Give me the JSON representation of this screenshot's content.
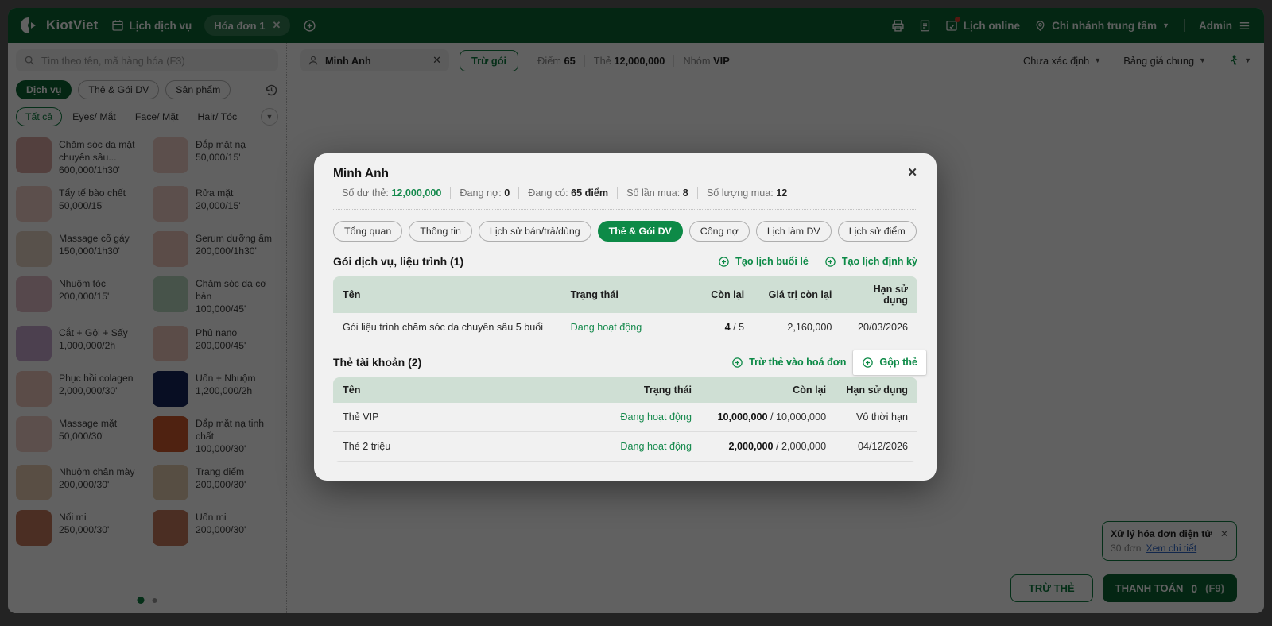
{
  "topbar": {
    "brand": "KiotViet",
    "schedule": "Lịch dịch vụ",
    "invoice_tab": "Hóa đơn 1",
    "lich_online": "Lịch online",
    "branch": "Chi nhánh trung tâm",
    "admin": "Admin"
  },
  "sidebar": {
    "search_placeholder": "Tìm theo tên, mã hàng hóa (F3)",
    "type_chips": [
      {
        "label": "Dịch vụ",
        "active": true
      },
      {
        "label": "Thẻ & Gói DV"
      },
      {
        "label": "Sản phẩm"
      }
    ],
    "categories": [
      {
        "label": "Tất cả",
        "active": true
      },
      {
        "label": "Eyes/ Mắt"
      },
      {
        "label": "Face/ Mặt"
      },
      {
        "label": "Hair/ Tóc"
      }
    ],
    "services": [
      {
        "name": "Chăm sóc da mặt chuyên sâu...",
        "price": "600,000/1h30'",
        "thumb": "#dba9a4"
      },
      {
        "name": "Đắp mặt nạ",
        "price": "50,000/15'",
        "thumb": "#f2cfc8"
      },
      {
        "name": "Tẩy tế bào chết",
        "price": "50,000/15'",
        "thumb": "#f2cfc8"
      },
      {
        "name": "Rửa mặt",
        "price": "20,000/15'",
        "thumb": "#f2cfc8"
      },
      {
        "name": "Massage cổ gáy",
        "price": "150,000/1h30'",
        "thumb": "#e8d6c6"
      },
      {
        "name": "Serum dưỡng ẩm",
        "price": "200,000/1h30'",
        "thumb": "#eec7bd"
      },
      {
        "name": "Nhuộm tóc",
        "price": "200,000/15'",
        "thumb": "#e3bdc8"
      },
      {
        "name": "Chăm sóc da cơ bản",
        "price": "100,000/45'",
        "thumb": "#bcd9c3"
      },
      {
        "name": "Cắt + Gội + Sấy",
        "price": "1,000,000/2h",
        "thumb": "#c9a9cf"
      },
      {
        "name": "Phủ nano",
        "price": "200,000/45'",
        "thumb": "#eec7bd"
      },
      {
        "name": "Phục hồi colagen",
        "price": "2,000,000/30'",
        "thumb": "#eec7bd"
      },
      {
        "name": "Uốn + Nhuộm",
        "price": "1,200,000/2h",
        "thumb": "#16255c"
      },
      {
        "name": "Massage mặt",
        "price": "50,000/30'",
        "thumb": "#f2cfc8"
      },
      {
        "name": "Đắp mặt nạ tinh chất",
        "price": "100,000/30'",
        "thumb": "#cf5b2e"
      },
      {
        "name": "Nhuộm chân mày",
        "price": "200,000/30'",
        "thumb": "#e9cdb4"
      },
      {
        "name": "Trang điểm",
        "price": "200,000/30'",
        "thumb": "#e5cdb0"
      },
      {
        "name": "Nối mi",
        "price": "250,000/30'",
        "thumb": "#c6795c"
      },
      {
        "name": "Uốn mi",
        "price": "200,000/30'",
        "thumb": "#c6795c"
      }
    ]
  },
  "main": {
    "customer_name": "Minh Anh",
    "tru_goi": "Trừ gói",
    "customer_stats": [
      {
        "label": "Điểm ",
        "value": "65"
      },
      {
        "label": "Thẻ ",
        "value": "12,000,000"
      },
      {
        "label": "Nhóm ",
        "value": "VIP"
      }
    ],
    "price_channel": "Chưa xác định",
    "price_list": "Bảng giá chung"
  },
  "modal": {
    "title": "Minh Anh",
    "stats": [
      {
        "label": "Số dư thẻ: ",
        "value": "12,000,000",
        "green": true
      },
      {
        "label": "Đang nợ: ",
        "value": "0"
      },
      {
        "label": "Đang có: ",
        "value": "65 điểm"
      },
      {
        "label": "Số lần mua: ",
        "value": "8"
      },
      {
        "label": "Số lượng mua: ",
        "value": "12"
      }
    ],
    "tabs": [
      {
        "label": "Tổng quan"
      },
      {
        "label": "Thông tin"
      },
      {
        "label": "Lịch sử bán/trả/dùng"
      },
      {
        "label": "Thẻ & Gói DV",
        "active": true
      },
      {
        "label": "Công nợ"
      },
      {
        "label": "Lịch làm DV"
      },
      {
        "label": "Lịch sử điểm"
      }
    ],
    "packages": {
      "title": "Gói dịch vụ, liệu trình (1)",
      "action1": "Tạo lịch buổi lẻ",
      "action2": "Tạo lịch định kỳ",
      "headers": {
        "name": "Tên",
        "status": "Trạng thái",
        "remaining": "Còn lại",
        "value": "Giá trị còn lại",
        "expiry": "Hạn sử dụng"
      },
      "rows": [
        {
          "name": "Gói liệu trình chăm sóc da chuyên sâu 5 buổi",
          "status": "Đang hoạt động",
          "remaining": "4",
          "remaining_rest": " / 5",
          "value": "2,160,000",
          "expiry": "20/03/2026"
        }
      ]
    },
    "cards": {
      "title": "Thẻ tài khoản (2)",
      "action1": "Trừ thẻ vào hoá đơn",
      "action2": "Gộp thẻ",
      "headers": {
        "name": "Tên",
        "status": "Trạng thái",
        "remaining": "Còn lại",
        "expiry": "Hạn sử dụng"
      },
      "rows": [
        {
          "name": "Thẻ VIP",
          "status": "Đang hoạt động",
          "remaining": "10,000,000",
          "remaining_rest": " / 10,000,000",
          "expiry": "Vô thời hạn"
        },
        {
          "name": "Thẻ 2 triệu",
          "status": "Đang hoạt động",
          "remaining": "2,000,000",
          "remaining_rest": " / 2,000,000",
          "expiry": "04/12/2026"
        }
      ]
    }
  },
  "notification": {
    "title": "Xử lý hóa đơn điện tử",
    "count": "30 đơn",
    "link": "Xem chi tiết"
  },
  "footer": {
    "tru_the": "TRỪ THẺ",
    "checkout": "THANH TOÁN",
    "amount": "0",
    "hotkey": "(F9)"
  },
  "colors": {
    "topbar_green": "#0d6434",
    "accent_green": "#0f7d3f",
    "active_tab_green": "#0d8a47",
    "status_green": "#168a4d",
    "table_header": "#cfdfd4",
    "link_blue": "#3068c8",
    "notification_dot": "#e0402e"
  }
}
